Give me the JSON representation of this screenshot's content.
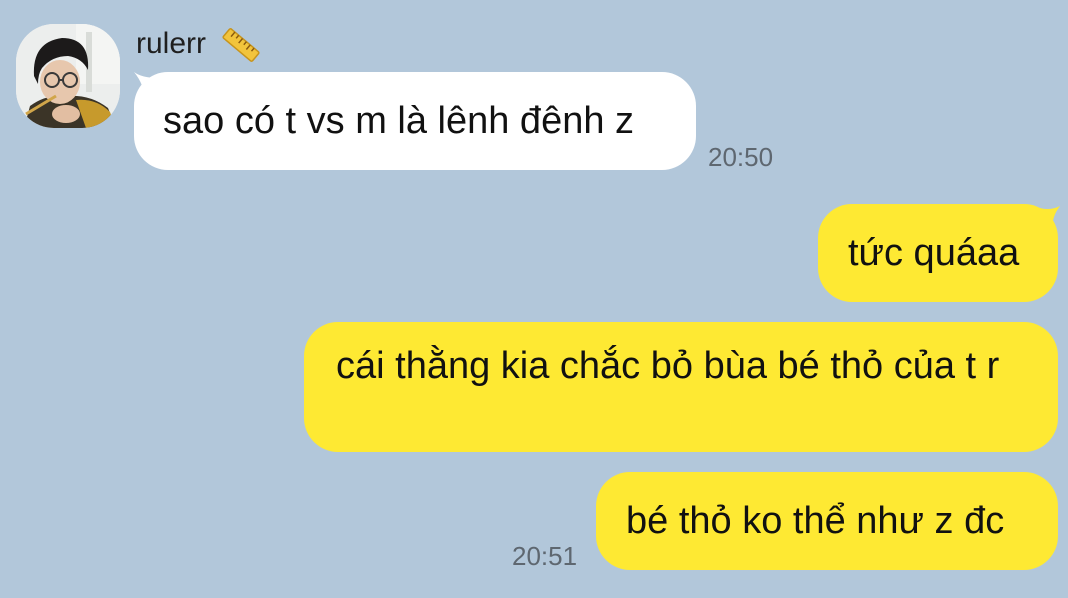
{
  "contact": {
    "name": "rulerr",
    "name_emoji_icon": "ruler-icon",
    "avatar_icon": "profile-photo"
  },
  "messages": [
    {
      "direction": "incoming",
      "text": "sao có t vs m là lênh đênh z",
      "time": "20:50"
    },
    {
      "direction": "outgoing",
      "text": "tức quáaa"
    },
    {
      "direction": "outgoing",
      "text": "cái thằng kia chắc bỏ bùa bé thỏ của t r"
    },
    {
      "direction": "outgoing",
      "text": "bé thỏ ko thể như z đc",
      "time": "20:51"
    }
  ],
  "colors": {
    "background": "#b2c7da",
    "incoming_bubble": "#ffffff",
    "outgoing_bubble": "#fee933",
    "timestamp": "#5e6770"
  }
}
